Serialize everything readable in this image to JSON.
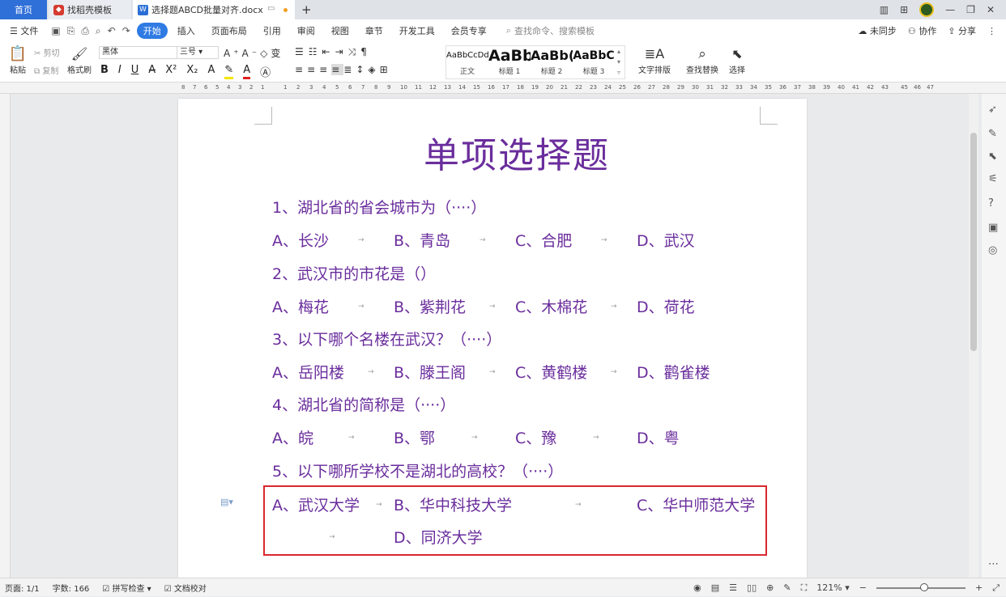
{
  "tabs": {
    "home": "首页",
    "template": "找稻壳模板",
    "document": "选择题ABCD批量对齐.docx"
  },
  "menu": {
    "file": "文件",
    "items": [
      "开始",
      "插入",
      "页面布局",
      "引用",
      "审阅",
      "视图",
      "章节",
      "开发工具",
      "会员专享"
    ],
    "active": "开始",
    "search_placeholder": "查找命令、搜索模板",
    "sync": "未同步",
    "collab": "协作",
    "share": "分享"
  },
  "ribbon": {
    "paste": "粘贴",
    "cut": "剪切",
    "copy": "复制",
    "format_painter": "格式刷",
    "font": "黑体",
    "size": "三号",
    "styles": [
      {
        "preview": "AaBbCcDd",
        "name": "正文"
      },
      {
        "preview": "AaBb",
        "name": "标题 1"
      },
      {
        "preview": "AaBb(",
        "name": "标题 2"
      },
      {
        "preview": "AaBbC",
        "name": "标题 3"
      }
    ],
    "text_layout": "文字排版",
    "find_replace": "查找替换",
    "select": "选择"
  },
  "document": {
    "title": "单项选择题",
    "questions": [
      {
        "q": "1、湖北省的省会城市为（····）",
        "options": [
          "A、长沙",
          "B、青岛",
          "C、合肥",
          "D、武汉"
        ]
      },
      {
        "q": "2、武汉市的市花是（）",
        "options": [
          "A、梅花",
          "B、紫荆花",
          "C、木棉花",
          "D、荷花"
        ]
      },
      {
        "q": "3、以下哪个名楼在武汉？（····）",
        "options": [
          "A、岳阳楼",
          "B、滕王阁",
          "C、黄鹤楼",
          "D、鹳雀楼"
        ]
      },
      {
        "q": "4、湖北省的简称是（····）",
        "options": [
          "A、皖",
          "B、鄂",
          "C、豫",
          "D、粤"
        ]
      },
      {
        "q": "5、以下哪所学校不是湖北的高校？（····）",
        "options": [
          "A、武汉大学",
          "B、华中科技大学",
          "C、华中师范大学",
          "D、同济大学"
        ]
      }
    ]
  },
  "status": {
    "page": "页面: 1/1",
    "words": "字数: 166",
    "spellcheck": "拼写检查",
    "proof": "文档校对",
    "zoom": "121%"
  },
  "colors": {
    "text_purple": "#6a2d9c",
    "accent_blue": "#2f7be3",
    "highlight_red": "#d9282f"
  }
}
